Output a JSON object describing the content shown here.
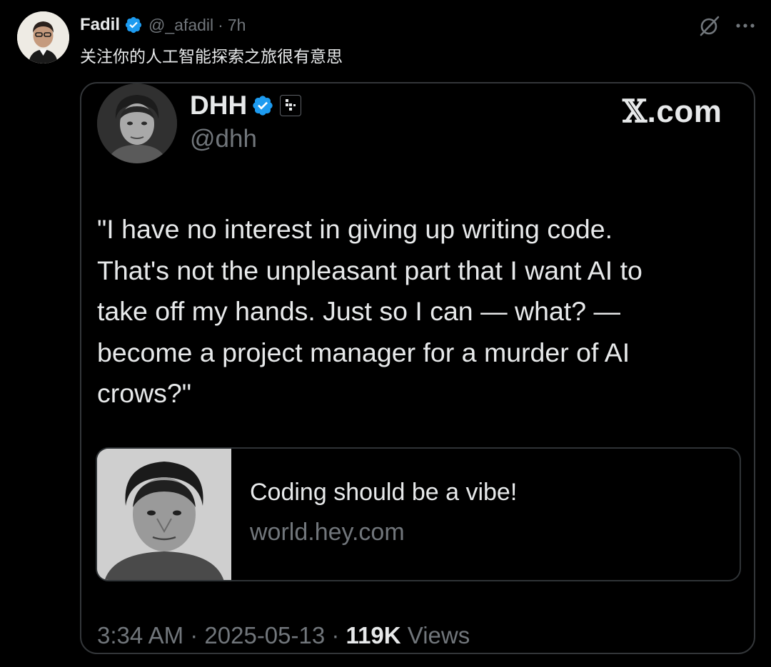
{
  "outer_post": {
    "author_name": "Fadil",
    "handle": "@_afadil",
    "separator": "·",
    "time_ago": "7h",
    "text": "关注你的人工智能探索之旅很有意思",
    "avatar_icon": "person-avatar",
    "verified_icon": "verified-badge-icon",
    "actions": [
      "grok-icon",
      "more-icon"
    ]
  },
  "quoted_post": {
    "author_name": "DHH",
    "handle": "@dhh",
    "verified_icon": "verified-badge-icon",
    "affiliate_icon": "affiliate-badge-icon",
    "brand_x": "𝕏",
    "brand_suffix": ".com",
    "body_lines": [
      "\"I have no interest in giving up writing code.",
      "That's not the unpleasant part that I want AI to",
      "take off my hands. Just so I can — what? —",
      "become a project manager for a murder of AI",
      "crows?\""
    ],
    "link_card": {
      "title": "Coding should be a vibe!",
      "domain": "world.hey.com",
      "thumbnail_icon": "person-photo"
    },
    "footer": {
      "time": "3:34 AM",
      "sep1": " · ",
      "date": "2025-05-13",
      "sep2": " · ",
      "views_count": "119K",
      "views_label": " Views"
    }
  },
  "colors": {
    "background": "#000000",
    "text_primary": "#e7e9ea",
    "text_secondary": "#71767b",
    "border": "#333639",
    "verified_blue": "#1d9bf0"
  }
}
